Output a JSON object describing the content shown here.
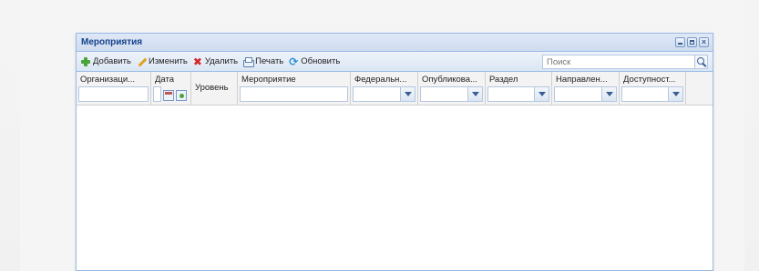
{
  "window": {
    "title": "Мероприятия"
  },
  "toolbar": {
    "add_label": "Добавить",
    "edit_label": "Изменить",
    "delete_label": "Удалить",
    "print_label": "Печать",
    "refresh_label": "Обновить"
  },
  "search": {
    "placeholder": "Поиск"
  },
  "columns": {
    "organization": "Организаци...",
    "date": "Дата",
    "level": "Уровень",
    "event": "Мероприятие",
    "federal": "Федеральн...",
    "published": "Опубликова...",
    "section": "Раздел",
    "direction": "Направлен...",
    "availability": "Доступност..."
  }
}
